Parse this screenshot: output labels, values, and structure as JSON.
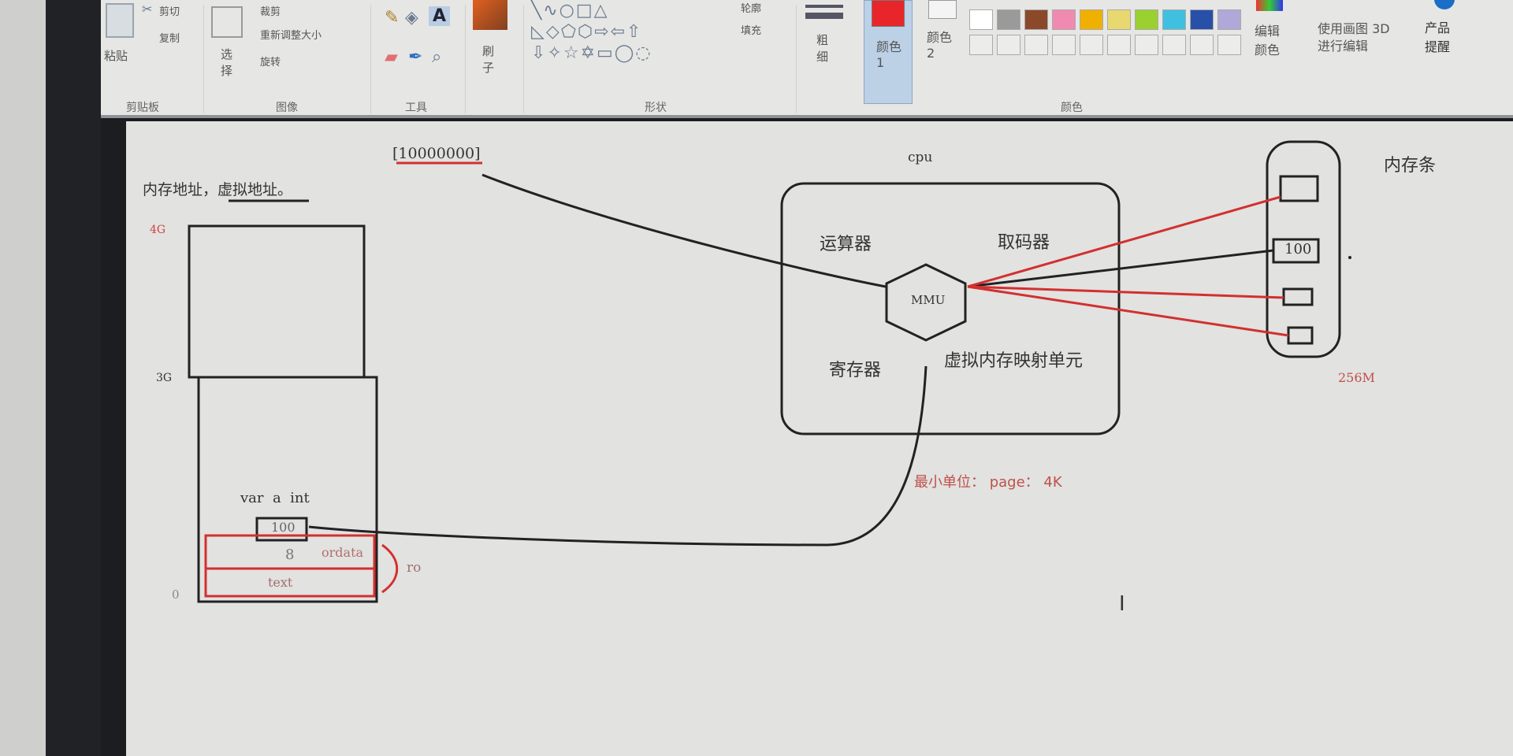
{
  "ribbon": {
    "clipboard": {
      "paste": "粘贴",
      "cut": "剪切",
      "copy": "复制",
      "group": "剪贴板"
    },
    "image": {
      "select": "选择",
      "crop": "裁剪",
      "resize": "重新调整大小",
      "rotate": "旋转",
      "group": "图像"
    },
    "tools": {
      "group": "工具"
    },
    "brush": "刷子",
    "shapes": {
      "outline": "轮廓",
      "fill": "填充",
      "group": "形状"
    },
    "size": "粗细",
    "colors": {
      "color1": "颜色 1",
      "color2": "颜色 2",
      "group": "颜色",
      "edit": "编辑颜色",
      "paint3d": "使用画图 3D 进行编辑",
      "color1_value": "#e8262a",
      "palette": [
        "#ffffff",
        "#9a9a9a",
        "#8a4a2a",
        "#f08ab0",
        "#f0b000",
        "#e8d870",
        "#9ad030",
        "#40c0e0",
        "#2850a8",
        "#b0a8d8"
      ]
    },
    "product_alert": "产品提醒"
  },
  "diagram": {
    "title": "内存地址，虚拟地址。",
    "address": "[10000000]",
    "axis": {
      "top": "4G",
      "mid": "3G",
      "bottom": "0"
    },
    "variable": "var  a  int",
    "value": "100",
    "ro_segments": {
      "ordata_value": "8",
      "ordata": "ordata",
      "text": "text",
      "group": "ro"
    },
    "cpu": {
      "label": "cpu",
      "alu": "运算器",
      "fetch": "取码器",
      "register": "寄存器",
      "mmu": "MMU",
      "mmu_desc": "虚拟内存映射单元"
    },
    "min_unit": "最小单位： page： 4K",
    "memory": {
      "label": "内存条",
      "cell_value": "100",
      "size": "256M"
    }
  }
}
